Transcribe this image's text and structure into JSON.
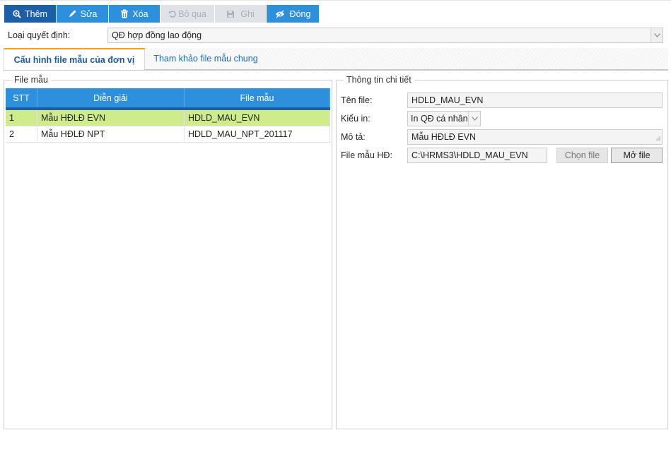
{
  "toolbar": {
    "add_label": "Thêm",
    "edit_label": "Sửa",
    "delete_label": "Xóa",
    "skip_label": "Bỏ qua",
    "save_label": "Ghi",
    "close_label": "Đóng",
    "add_icon": "zoom-plus-icon",
    "edit_icon": "pencil-icon",
    "delete_icon": "trash-icon",
    "skip_icon": "undo-icon",
    "save_icon": "save-icon",
    "close_icon": "eye-icon"
  },
  "decision": {
    "label": "Loại quyết định:",
    "value": "QĐ hợp đồng lao động"
  },
  "tabs": [
    {
      "label": "Cấu hình file mẫu của đơn vị",
      "active": true
    },
    {
      "label": "Tham khảo file mẫu chung",
      "active": false
    }
  ],
  "template_panel": {
    "legend": "File mẫu",
    "columns": [
      "STT",
      "Diễn giải",
      "File mẫu"
    ],
    "rows": [
      {
        "stt": "1",
        "description": "Mẫu HĐLĐ EVN",
        "file": "HDLD_MAU_EVN",
        "selected": true
      },
      {
        "stt": "2",
        "description": "Mẫu HĐLĐ NPT",
        "file": "HDLD_MAU_NPT_201117",
        "selected": false
      }
    ]
  },
  "detail_panel": {
    "legend": "Thông tin chi tiết",
    "file_name_label": "Tên file:",
    "file_name_value": "HDLD_MAU_EVN",
    "print_type_label": "Kiểu in:",
    "print_type_value": "In QĐ cá nhân",
    "description_label": "Mô tả:",
    "description_value": "Mẫu HĐLĐ EVN",
    "template_file_label": "File mẫu HĐ:",
    "template_file_value": "C:\\HRMS3\\HDLD_MAU_EVN",
    "choose_file_label": "Chọn file",
    "open_file_label": "Mở file"
  },
  "colors": {
    "toolbar_blue": "#2e90dc",
    "toolbar_active": "#1c5fa8",
    "selected_row": "#cfeb8b",
    "tab_accent": "#f0a21b"
  }
}
